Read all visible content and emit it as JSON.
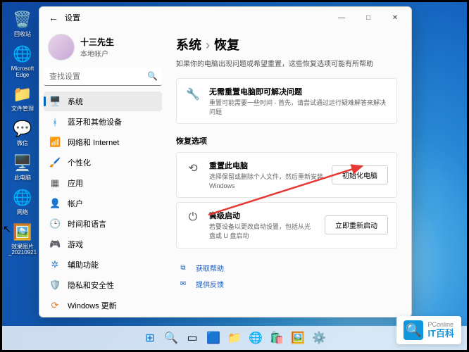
{
  "desktop": {
    "icons": [
      {
        "label": "回收站",
        "glyph": "🗑️"
      },
      {
        "label": "Microsoft Edge",
        "glyph": "🌐"
      },
      {
        "label": "文件管理",
        "glyph": "📁"
      },
      {
        "label": "微信",
        "glyph": "💬"
      },
      {
        "label": "此电脑",
        "glyph": "🖥️"
      },
      {
        "label": "网络",
        "glyph": "🌐"
      },
      {
        "label": "效果图片_20210921",
        "glyph": "🖼️"
      }
    ]
  },
  "window": {
    "title": "设置",
    "controls": {
      "min": "—",
      "max": "□",
      "close": "✕"
    }
  },
  "user": {
    "name": "十三先生",
    "sub": "本地帐户"
  },
  "search": {
    "placeholder": "查找设置"
  },
  "nav": [
    {
      "icon": "🖥️",
      "label": "系统",
      "color": "#0067c0",
      "active": true
    },
    {
      "icon": "ᚼ",
      "label": "蓝牙和其他设备",
      "color": "#0078d4"
    },
    {
      "icon": "📶",
      "label": "网络和 Internet",
      "color": "#2b7cd3"
    },
    {
      "icon": "🖌️",
      "label": "个性化",
      "color": "#b146c2"
    },
    {
      "icon": "▦",
      "label": "应用",
      "color": "#555"
    },
    {
      "icon": "👤",
      "label": "帐户",
      "color": "#2aa57a"
    },
    {
      "icon": "🕒",
      "label": "时间和语言",
      "color": "#2b7cd3"
    },
    {
      "icon": "🎮",
      "label": "游戏",
      "color": "#2aa57a"
    },
    {
      "icon": "✲",
      "label": "辅助功能",
      "color": "#2b7cd3"
    },
    {
      "icon": "🛡️",
      "label": "隐私和安全性",
      "color": "#777"
    },
    {
      "icon": "⟳",
      "label": "Windows 更新",
      "color": "#e67e22"
    }
  ],
  "content": {
    "breadcrumb": {
      "root": "系统",
      "current": "恢复"
    },
    "subtitle": "如果你的电脑出现问题或希望重置，这些恢复选项可能有所帮助",
    "tip": {
      "title": "无需重置电脑即可解决问题",
      "desc": "重置可能需要一些时间 - 首先，请尝试通过运行疑难解答来解决问题"
    },
    "section": "恢复选项",
    "cards": [
      {
        "icon": "⟲",
        "title": "重置此电脑",
        "desc": "选择保留或删除个人文件，然后重新安装 Windows",
        "button": "初始化电脑"
      },
      {
        "icon": "⏻",
        "title": "高级启动",
        "desc": "若要设备以更改启动设置，包括从光盘或 U 盘启动",
        "button": "立即重新启动"
      }
    ],
    "links": [
      {
        "icon": "⧉",
        "label": "获取帮助"
      },
      {
        "icon": "✉",
        "label": "提供反馈"
      }
    ]
  },
  "watermark": {
    "top": "PConline",
    "bottom": "IT百科"
  }
}
